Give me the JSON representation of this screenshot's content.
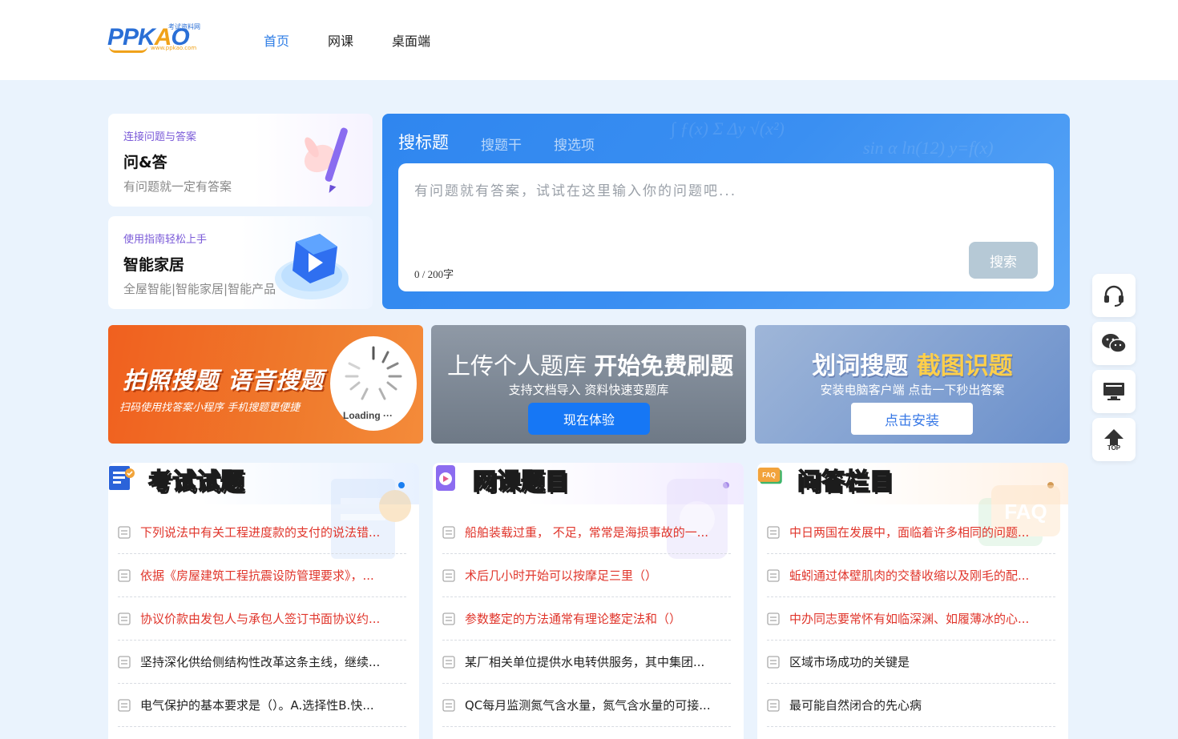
{
  "header": {
    "logo": {
      "main": "PPKAO",
      "tagline": "考试资料网",
      "url": "www.ppkao.com"
    },
    "nav": [
      {
        "label": "首页",
        "active": true
      },
      {
        "label": "网课",
        "active": false
      },
      {
        "label": "桌面端",
        "active": false
      }
    ]
  },
  "promos": [
    {
      "subtitle": "连接问题与答案",
      "title": "问&答",
      "desc": "有问题就一定有答案"
    },
    {
      "subtitle": "使用指南轻松上手",
      "title": "智能家居",
      "desc": "全屋智能|智能家居|智能产品"
    }
  ],
  "search": {
    "tabs": [
      {
        "label": "搜标题",
        "active": true
      },
      {
        "label": "搜题干",
        "active": false
      },
      {
        "label": "搜选项",
        "active": false
      }
    ],
    "placeholder": "有问题就有答案，试试在这里输入你的问题吧...",
    "char_count": "0 / 200字",
    "button": "搜索"
  },
  "banners": {
    "photo": {
      "title": "拍照搜题 语音搜题",
      "subtitle": "扫码使用找答案小程序 手机搜题更便捷",
      "loading": "Loading ···"
    },
    "upload": {
      "title_light": "上传个人题库 ",
      "title_bold": "开始免费刷题",
      "subtitle": "支持文档导入 资料快速变题库",
      "button": "现在体验"
    },
    "desktop": {
      "title_white": "划词搜题 ",
      "title_yellow": "截图识题",
      "subtitle": "安装电脑客户端 点击一下秒出答案",
      "button": "点击安装"
    }
  },
  "sections": [
    {
      "title": "考试试题",
      "icon": "exam-doc-icon",
      "items": [
        {
          "text": "下列说法中有关工程进度款的支付的说法错...",
          "hot": true
        },
        {
          "text": "依据《房屋建筑工程抗震设防管理要求》，...",
          "hot": true
        },
        {
          "text": "协议价款由发包人与承包人签订书面协议约...",
          "hot": true
        },
        {
          "text": "坚持深化供给侧结构性改革这条主线，继续...",
          "hot": false
        },
        {
          "text": "电气保护的基本要求是（）。A.选择性B.快...",
          "hot": false
        }
      ]
    },
    {
      "title": "网课题目",
      "icon": "video-course-icon",
      "items": [
        {
          "text": "船舶装载过重， 不足，常常是海损事故的一...",
          "hot": true
        },
        {
          "text": "术后几小时开始可以按摩足三里（）",
          "hot": true
        },
        {
          "text": "参数整定的方法通常有理论整定法和（）",
          "hot": true
        },
        {
          "text": "某厂相关单位提供水电转供服务，其中集团...",
          "hot": false
        },
        {
          "text": "QC每月监测氮气含水量，氮气含水量的可接...",
          "hot": false
        }
      ]
    },
    {
      "title": "问答栏目",
      "icon": "faq-icon",
      "items": [
        {
          "text": "中日两国在发展中，面临着许多相同的问题...",
          "hot": true
        },
        {
          "text": "蚯蚓通过体壁肌肉的交替收缩以及刚毛的配...",
          "hot": true
        },
        {
          "text": "中办同志要常怀有如临深渊、如履薄冰的心...",
          "hot": true
        },
        {
          "text": "区域市场成功的关键是",
          "hot": false
        },
        {
          "text": "最可能自然闭合的先心病",
          "hot": false
        }
      ]
    }
  ],
  "toolbar": {
    "items": [
      "headset-icon",
      "wechat-icon",
      "desktop-icon",
      "back-to-top-icon"
    ],
    "top_label": "TOP"
  }
}
